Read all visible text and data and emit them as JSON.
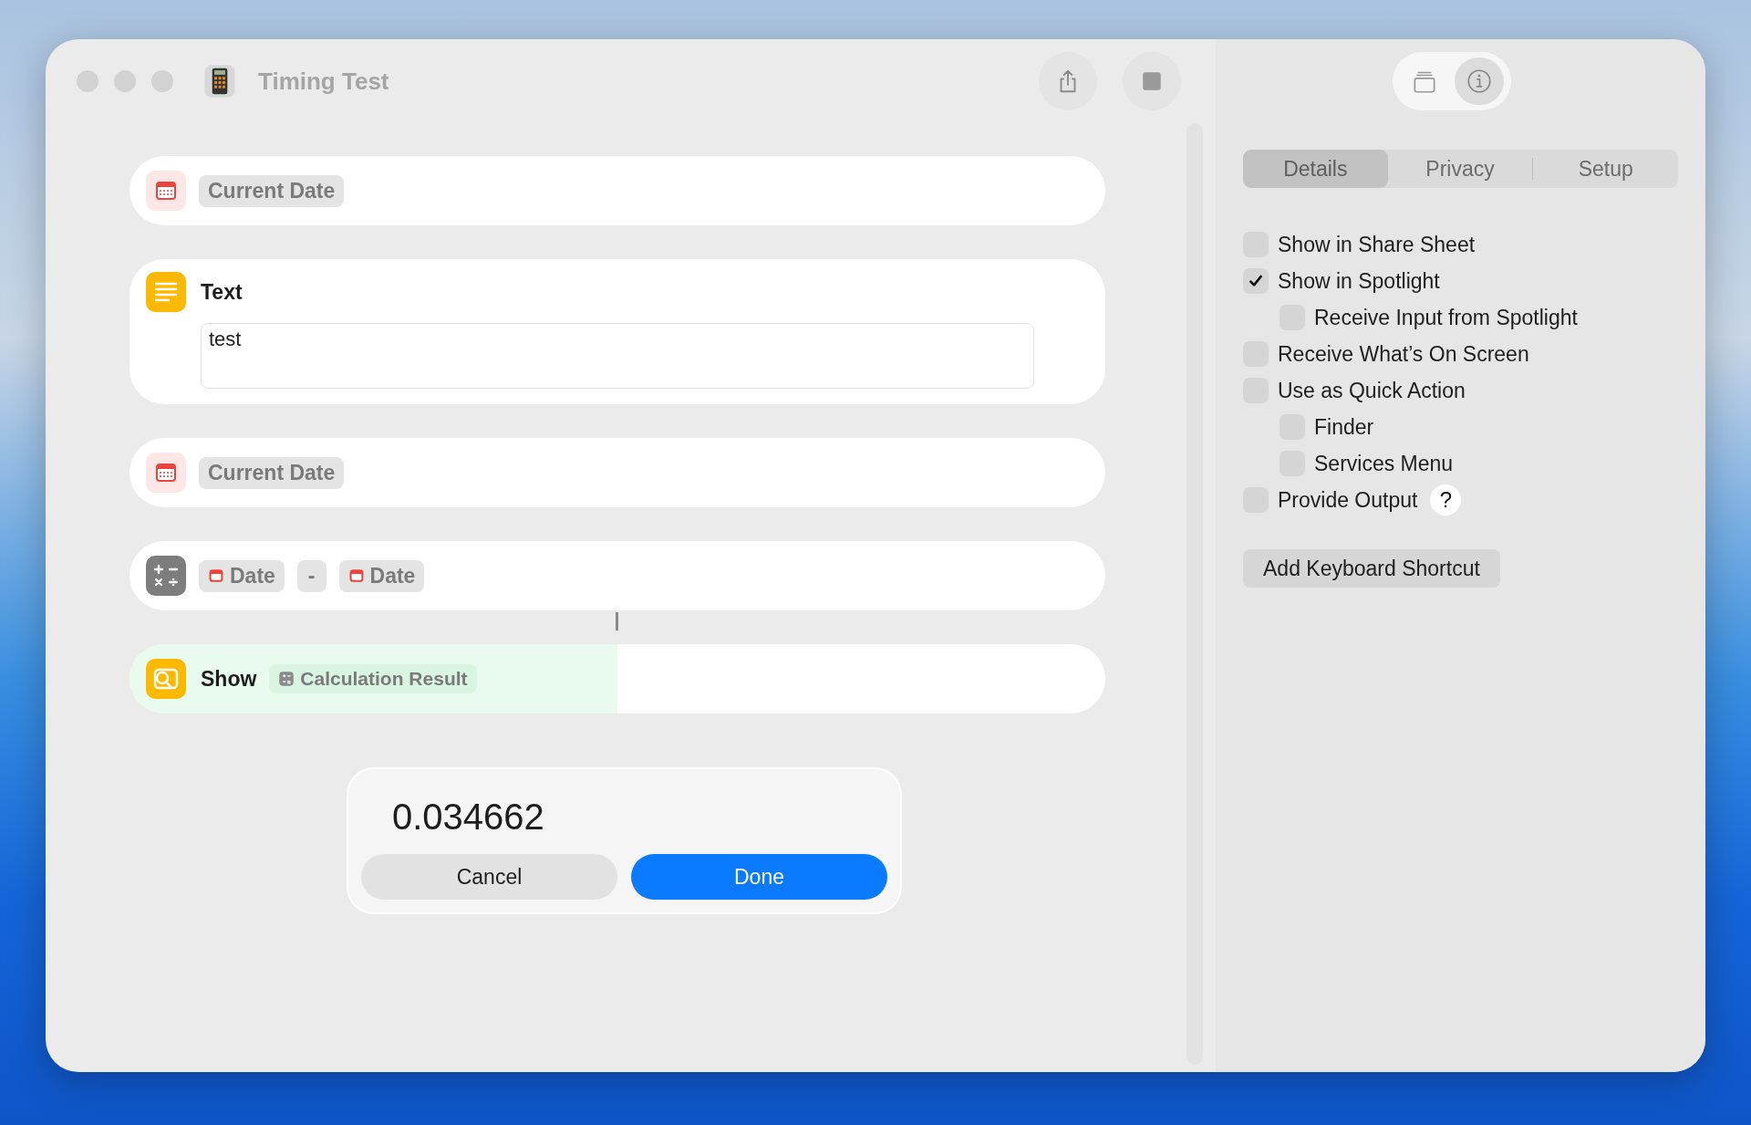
{
  "window": {
    "title": "Timing Test"
  },
  "actions": [
    {
      "kind": "variable",
      "tokens": [
        {
          "label": "Current Date",
          "kind": "name"
        }
      ]
    },
    {
      "kind": "text",
      "title": "Text",
      "value": "test"
    },
    {
      "kind": "variable",
      "tokens": [
        {
          "label": "Current Date",
          "kind": "name"
        }
      ]
    },
    {
      "kind": "calculate",
      "tokens": [
        {
          "label": "Date",
          "kind": "date"
        },
        {
          "label": "-",
          "kind": "operator"
        },
        {
          "label": "Date",
          "kind": "date"
        }
      ]
    },
    {
      "kind": "show",
      "title": "Show",
      "level": 0.5,
      "tokens": [
        {
          "label": "Calculation Result",
          "kind": "calc"
        }
      ]
    }
  ],
  "dialog": {
    "value": "0.034662",
    "buttons": [
      {
        "label": "Cancel",
        "kind": "secondary"
      },
      {
        "label": "Done",
        "kind": "primary"
      }
    ]
  },
  "sidebar": {
    "tabs": [
      {
        "label": "Details",
        "selected": true
      },
      {
        "label": "Privacy",
        "selected": false
      },
      {
        "label": "Setup",
        "selected": false
      }
    ],
    "options": [
      {
        "label": "Show in Share Sheet",
        "checked": false
      },
      {
        "label": "Show in Spotlight",
        "checked": true,
        "children": [
          {
            "label": "Receive Input from Spotlight",
            "checked": false
          }
        ]
      },
      {
        "label": "Receive What’s On Screen",
        "checked": false
      },
      {
        "label": "Use as Quick Action",
        "checked": false,
        "children": [
          {
            "label": "Finder",
            "checked": false
          },
          {
            "label": "Services Menu",
            "checked": false
          }
        ]
      },
      {
        "label": "Provide Output",
        "checked": false,
        "help": "?"
      }
    ],
    "button": "Add Keyboard Shortcut"
  }
}
